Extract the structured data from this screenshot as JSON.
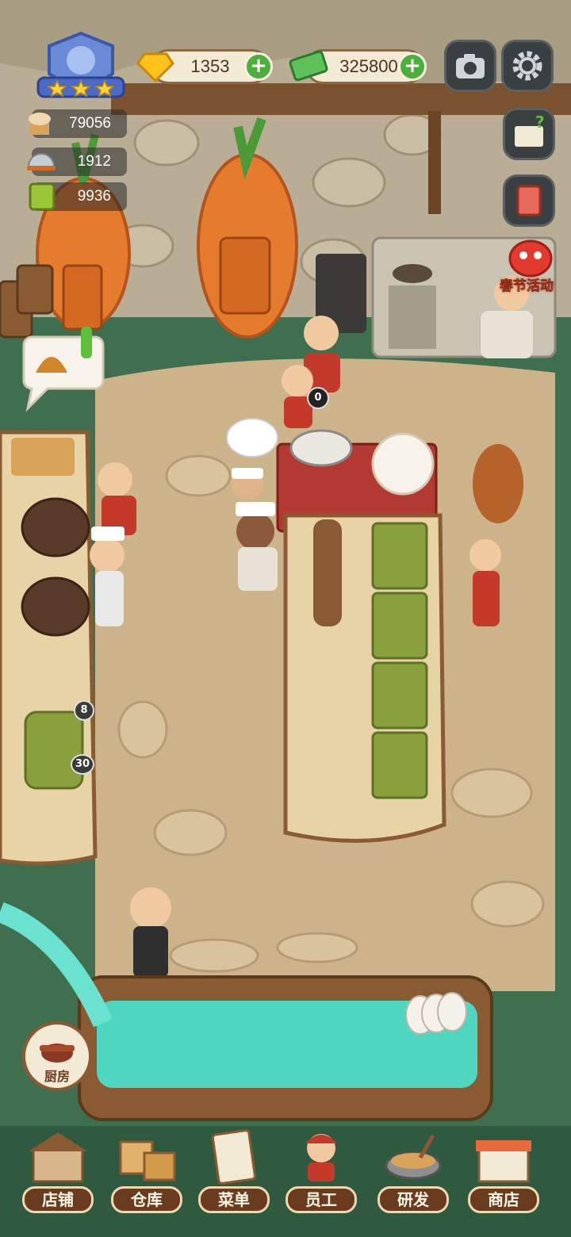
{
  "topbar": {
    "gems": "1353",
    "cash": "325800",
    "gem_icon": "gem-icon",
    "cash_icon": "cash-icon",
    "camera_icon": "camera-icon",
    "settings_icon": "gear-icon",
    "restaurant_rating_stars": 3
  },
  "stats": [
    {
      "icon": "chef-hat-icon",
      "value": "79056"
    },
    {
      "icon": "serving-cloche-icon",
      "value": "1912"
    },
    {
      "icon": "menu-book-icon",
      "value": "9936"
    }
  ],
  "side_buttons": {
    "guide_icon": "book-question-icon",
    "recipe_icon": "recipe-book-icon",
    "event_label": "春节活动"
  },
  "scene": {
    "order_counter": "0",
    "prep_counts": [
      "8",
      "30"
    ],
    "kitchen_label": "厨房"
  },
  "nav": [
    {
      "label": "店铺",
      "icon": "shop-building-icon"
    },
    {
      "label": "仓库",
      "icon": "warehouse-boxes-icon"
    },
    {
      "label": "菜单",
      "icon": "menu-clipboard-icon"
    },
    {
      "label": "员工",
      "icon": "staff-icon"
    },
    {
      "label": "研发",
      "icon": "cooking-pot-icon"
    },
    {
      "label": "商店",
      "icon": "store-icon"
    }
  ],
  "colors": {
    "grass": "#3f6f4e",
    "path": "#cdb38a",
    "wood": "#e8d3a6",
    "water": "#4fd6c0",
    "accent_green": "#4caf3c"
  }
}
